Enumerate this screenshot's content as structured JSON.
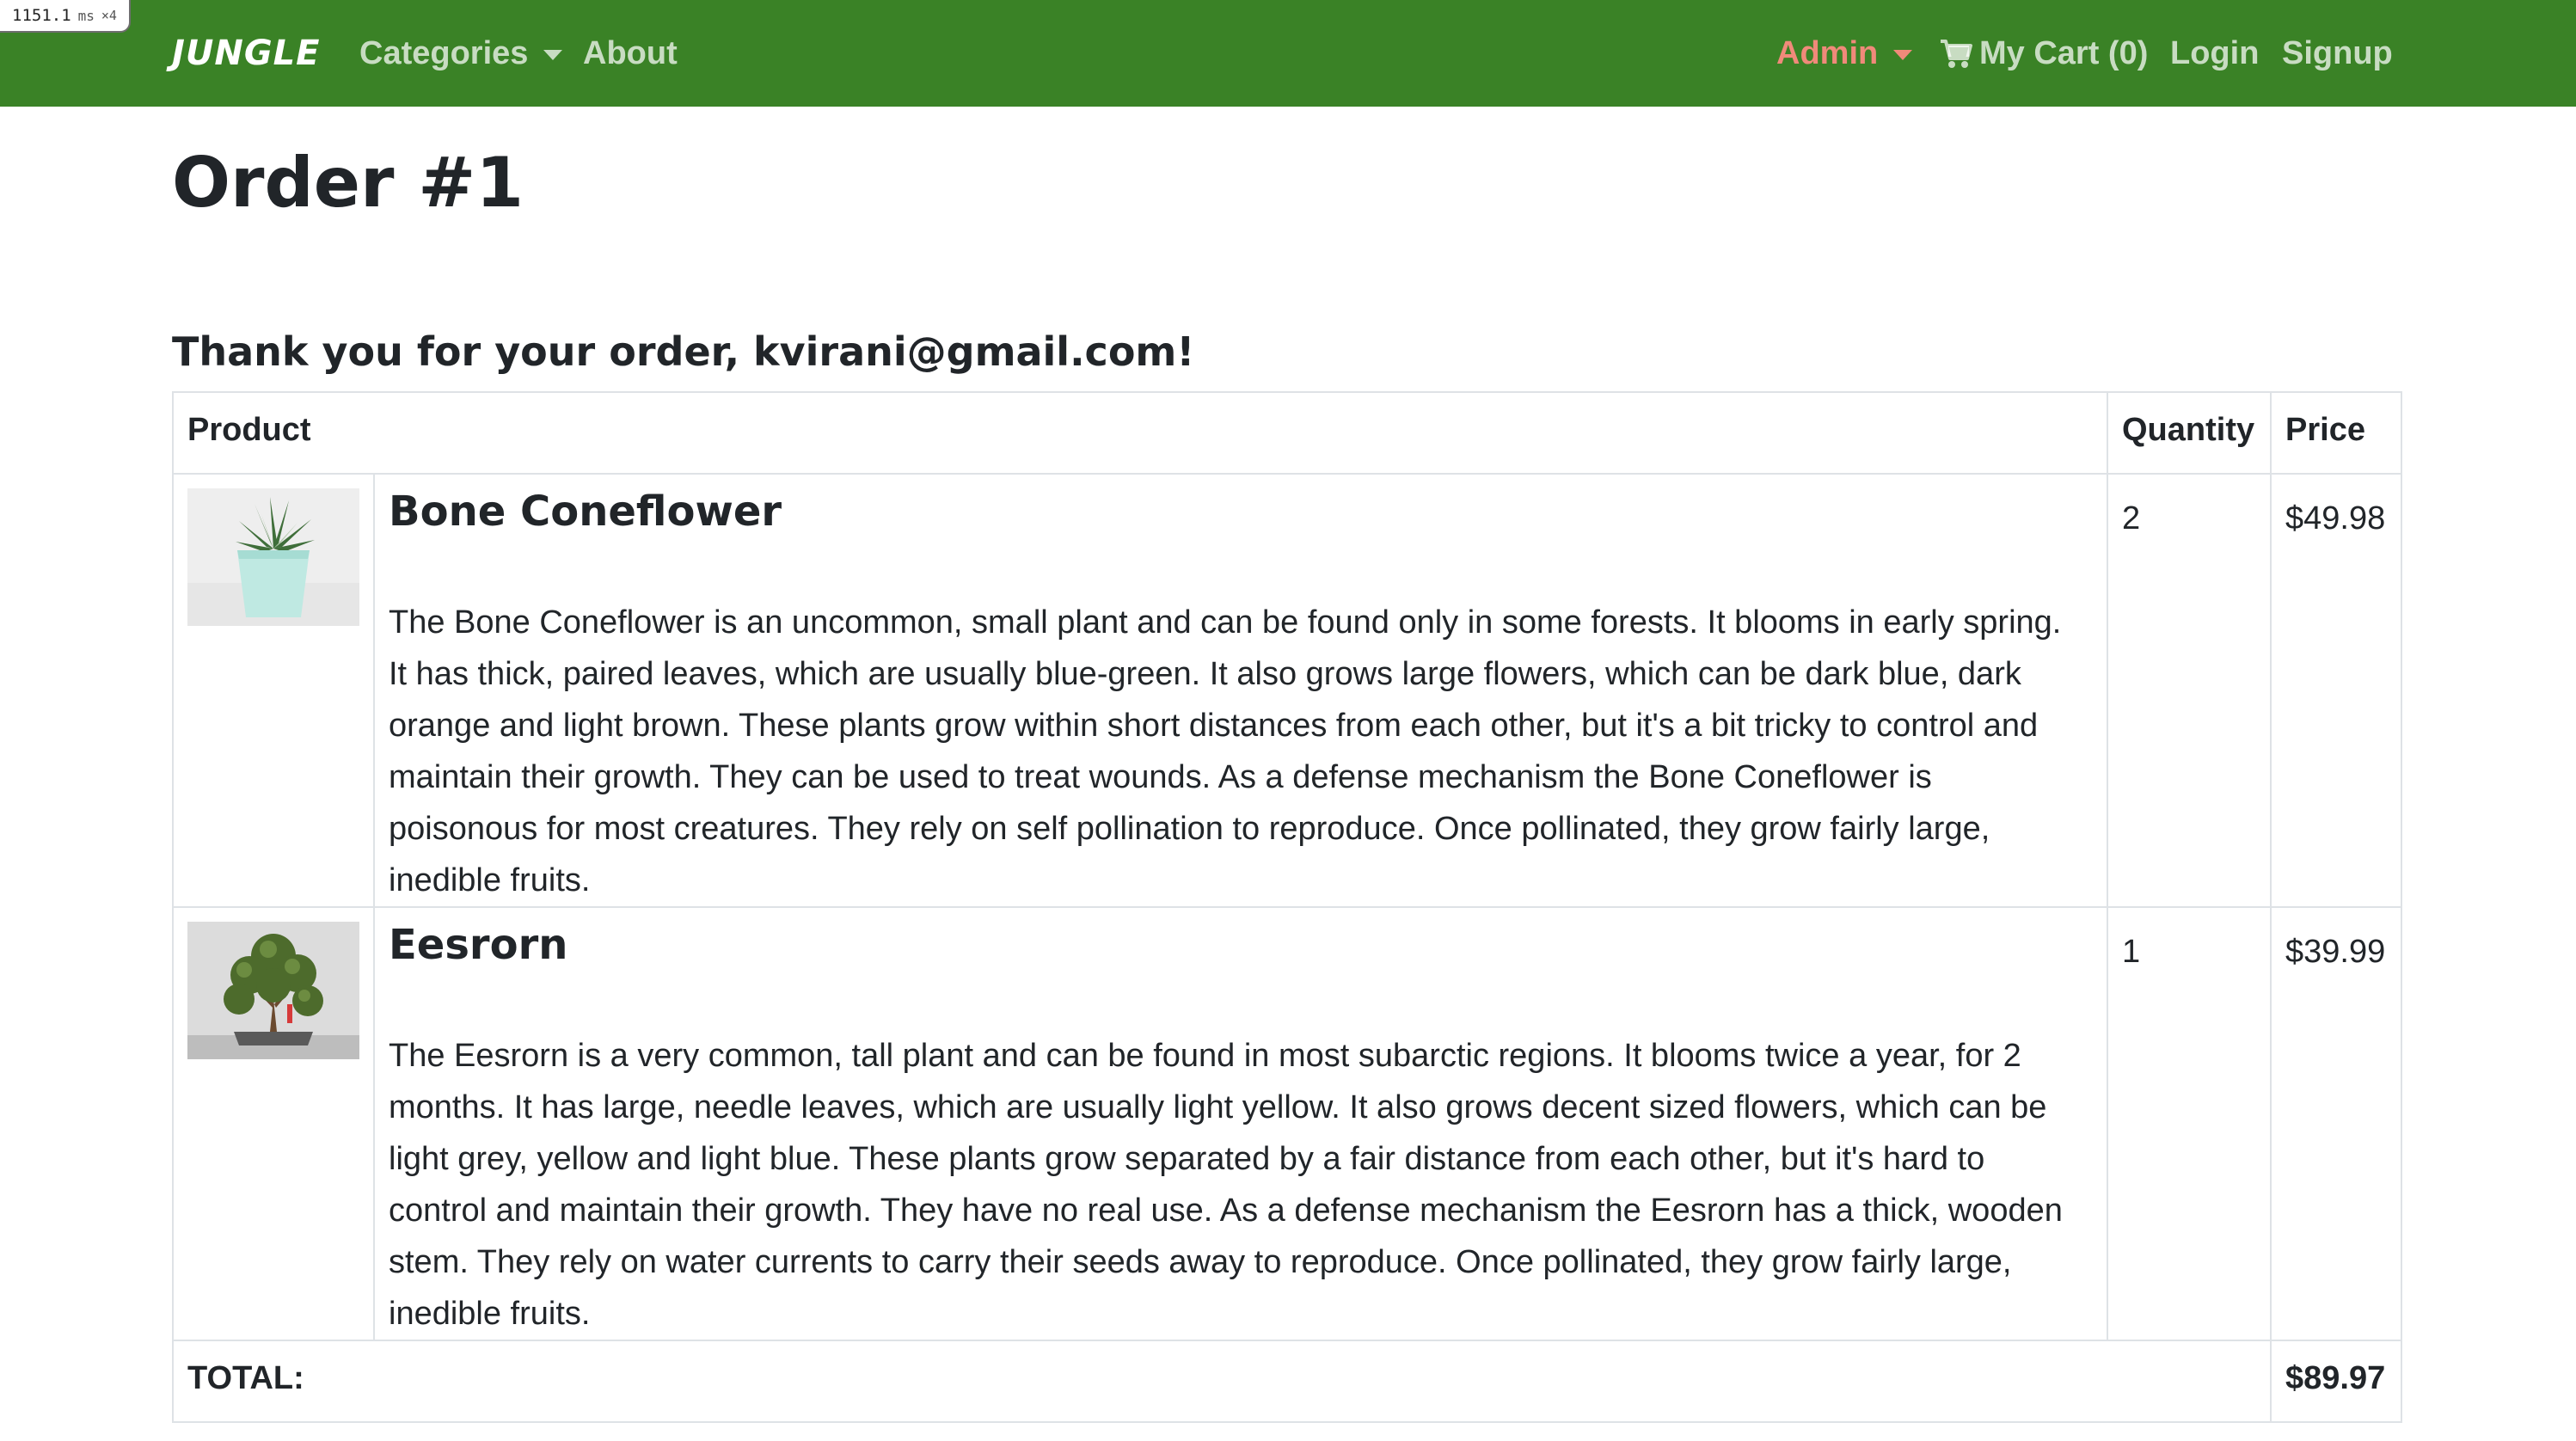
{
  "debug": {
    "time": "1151.1",
    "unit": "ms",
    "multiplier": "×4"
  },
  "nav": {
    "brand": "JUNGLE",
    "categories": "Categories",
    "about": "About",
    "admin": "Admin",
    "cart": "My Cart (0)",
    "login": "Login",
    "signup": "Signup",
    "colors": {
      "navbar_bg": "#3a8226",
      "admin_link": "#f08a7a"
    }
  },
  "page": {
    "title": "Order #1",
    "thank_you": "Thank you for your order, kvirani@gmail.com!"
  },
  "table": {
    "headers": {
      "product": "Product",
      "quantity": "Quantity",
      "price": "Price"
    },
    "items": [
      {
        "name": "Bone Coneflower",
        "description": "The Bone Coneflower is an uncommon, small plant and can be found only in some forests. It blooms in early spring. It has thick, paired leaves, which are usually blue-green. It also grows large flowers, which can be dark blue, dark orange and light brown. These plants grow within short distances from each other, but it's a bit tricky to control and maintain their growth. They can be used to treat wounds. As a defense mechanism the Bone Coneflower is poisonous for most creatures. They rely on self pollination to reproduce. Once pollinated, they grow fairly large, inedible fruits.",
        "quantity": "2",
        "price": "$49.98",
        "image": "succulent-in-mint-pot"
      },
      {
        "name": "Eesrorn",
        "description": "The Eesrorn is a very common, tall plant and can be found in most subarctic regions. It blooms twice a year, for 2 months. It has large, needle leaves, which are usually light yellow. It also grows decent sized flowers, which can be light grey, yellow and light blue. These plants grow separated by a fair distance from each other, but it's hard to control and maintain their growth. They have no real use. As a defense mechanism the Eesrorn has a thick, wooden stem. They rely on water currents to carry their seeds away to reproduce. Once pollinated, they grow fairly large, inedible fruits.",
        "quantity": "1",
        "price": "$39.99",
        "image": "bonsai-tree"
      }
    ],
    "total_label": "TOTAL:",
    "total_value": "$89.97"
  }
}
